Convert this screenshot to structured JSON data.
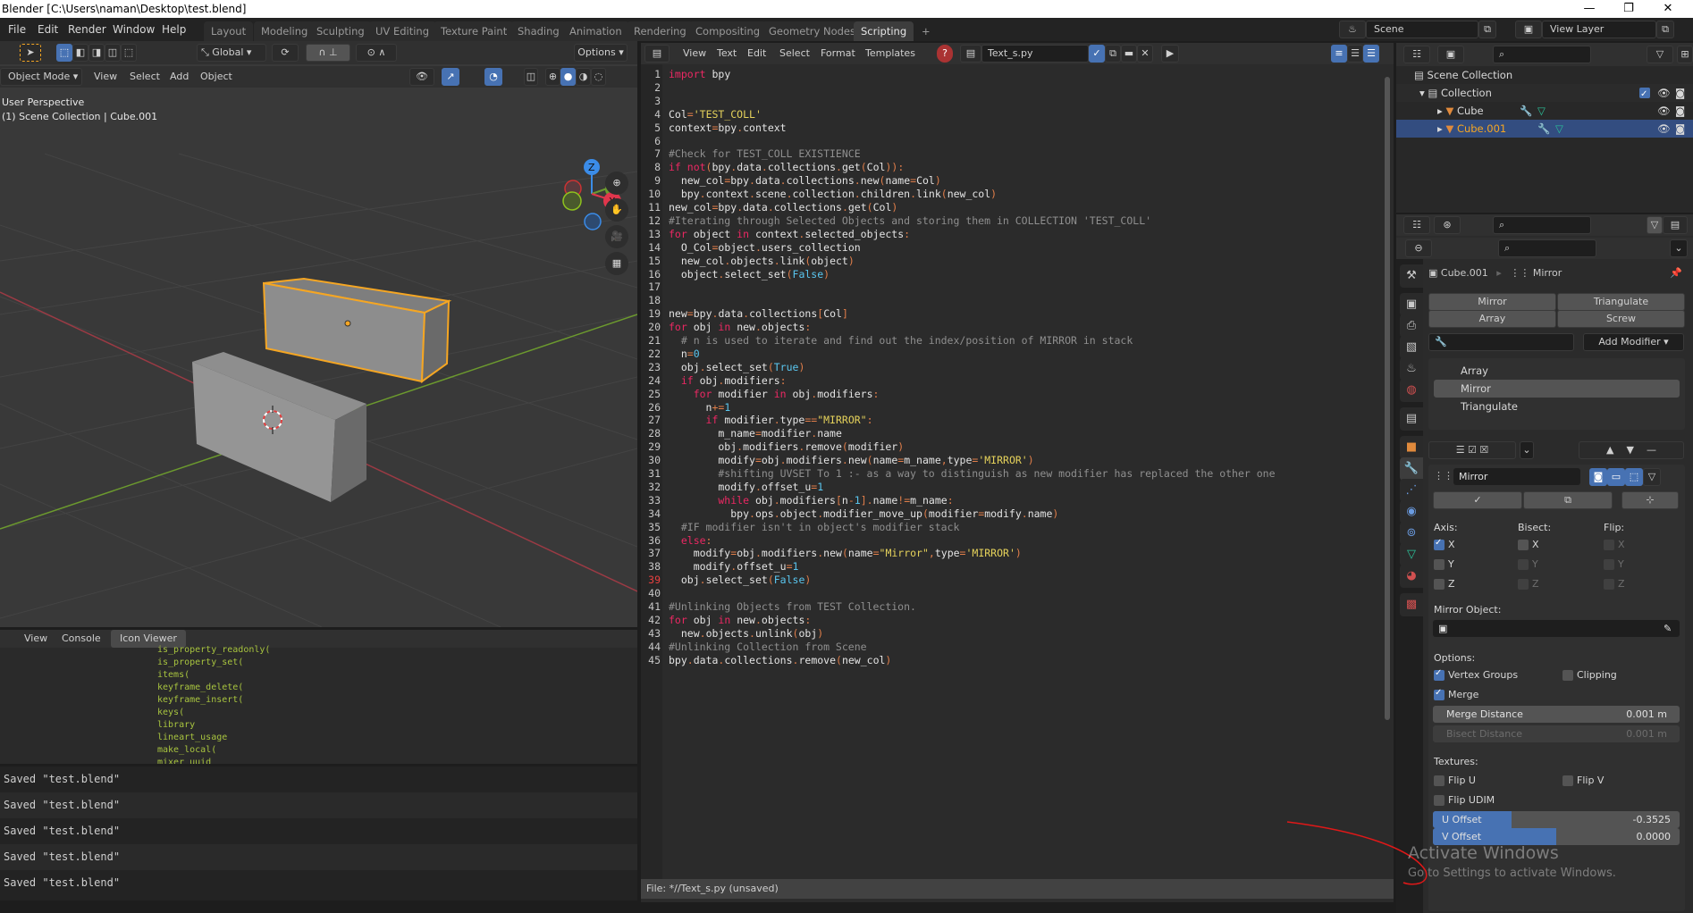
{
  "window": {
    "title": "Blender [C:\\Users\\naman\\Desktop\\test.blend]",
    "controls": {
      "minimize": "—",
      "maximize": "❐",
      "close": "✕"
    }
  },
  "menu": [
    "File",
    "Edit",
    "Render",
    "Window",
    "Help"
  ],
  "workspaces": {
    "tabs": [
      "Layout",
      "Modeling",
      "Sculpting",
      "UV Editing",
      "Texture Paint",
      "Shading",
      "Animation",
      "Rendering",
      "Compositing",
      "Geometry Nodes",
      "Scripting"
    ],
    "active": "Scripting",
    "add": "+"
  },
  "scene": {
    "name": "Scene",
    "view_layer": "View Layer"
  },
  "viewport": {
    "toolbar": {
      "orientation": "Global",
      "options": "Options"
    },
    "mode": "Object Mode",
    "menus": [
      "View",
      "Select",
      "Add",
      "Object"
    ],
    "overlay_text": [
      "User Perspective",
      "(1) Scene Collection | Cube.001"
    ],
    "gizmo": {
      "z": "Z",
      "y": "Y",
      "x": "X"
    }
  },
  "console": {
    "tabs": [
      "View",
      "Console",
      "Icon Viewer"
    ],
    "active_tab": "Icon Viewer",
    "lines": [
      "is_property_readonly(",
      "is_property_set(",
      "items(",
      "keyframe_delete(",
      "keyframe_insert(",
      "keys(",
      "library",
      "lineart_usage",
      "make_local(",
      "mixer_uuid"
    ]
  },
  "info_log": [
    "Saved \"test.blend\"",
    "Saved \"test.blend\"",
    "Saved \"test.blend\"",
    "Saved \"test.blend\"",
    "Saved \"test.blend\""
  ],
  "text_editor": {
    "menus": [
      "View",
      "Text",
      "Edit",
      "Select",
      "Format",
      "Templates"
    ],
    "filename": "Text_s.py",
    "footer": "File: *//Text_s.py (unsaved)",
    "current_line": 39,
    "code": [
      [
        [
          "k",
          "import"
        ],
        [
          "",
          "  bpy"
        ]
      ],
      [],
      [],
      [
        [
          "",
          "Col"
        ],
        [
          "p",
          "="
        ],
        [
          "s",
          "'TEST_COLL'"
        ]
      ],
      [
        [
          "",
          "context"
        ],
        [
          "p",
          "="
        ],
        [
          "",
          "bpy"
        ],
        [
          "p",
          "."
        ],
        [
          "",
          "context"
        ]
      ],
      [],
      [
        [
          "c",
          "#Check for TEST_COLL EXISTIENCE"
        ]
      ],
      [
        [
          "k",
          "if not"
        ],
        [
          "p",
          "("
        ],
        [
          "",
          "bpy"
        ],
        [
          "p",
          "."
        ],
        [
          "",
          "data"
        ],
        [
          "p",
          "."
        ],
        [
          "",
          "collections"
        ],
        [
          "p",
          "."
        ],
        [
          "",
          "get"
        ],
        [
          "p",
          "("
        ],
        [
          "",
          "Col"
        ],
        [
          "p",
          "))"
        ],
        [
          "p",
          ":"
        ]
      ],
      [
        [
          "",
          "    new_col"
        ],
        [
          "p",
          "="
        ],
        [
          "",
          "bpy"
        ],
        [
          "p",
          "."
        ],
        [
          "",
          "data"
        ],
        [
          "p",
          "."
        ],
        [
          "",
          "collections"
        ],
        [
          "p",
          "."
        ],
        [
          "",
          "new"
        ],
        [
          "p",
          "("
        ],
        [
          "",
          "name"
        ],
        [
          "p",
          "="
        ],
        [
          "",
          "Col"
        ],
        [
          "p",
          ")"
        ]
      ],
      [
        [
          "",
          "    bpy"
        ],
        [
          "p",
          "."
        ],
        [
          "",
          "context"
        ],
        [
          "p",
          "."
        ],
        [
          "",
          "scene"
        ],
        [
          "p",
          "."
        ],
        [
          "",
          "collection"
        ],
        [
          "p",
          "."
        ],
        [
          "",
          "children"
        ],
        [
          "p",
          "."
        ],
        [
          "",
          "link"
        ],
        [
          "p",
          "("
        ],
        [
          "",
          "new_col"
        ],
        [
          "p",
          ")"
        ]
      ],
      [
        [
          "",
          "new_col"
        ],
        [
          "p",
          "="
        ],
        [
          "",
          "bpy"
        ],
        [
          "p",
          "."
        ],
        [
          "",
          "data"
        ],
        [
          "p",
          "."
        ],
        [
          "",
          "collections"
        ],
        [
          "p",
          "."
        ],
        [
          "",
          "get"
        ],
        [
          "p",
          "("
        ],
        [
          "",
          "Col"
        ],
        [
          "p",
          ")"
        ]
      ],
      [
        [
          "c",
          "#Iterating through Selected Objects and storing them in COLLECTION 'TEST_COLL'"
        ]
      ],
      [
        [
          "k",
          "for"
        ],
        [
          "",
          "  object "
        ],
        [
          "k",
          "in"
        ],
        [
          "",
          "  context"
        ],
        [
          "p",
          "."
        ],
        [
          "",
          "selected_objects"
        ],
        [
          "p",
          ":"
        ]
      ],
      [
        [
          "",
          "    O_Col"
        ],
        [
          "p",
          "="
        ],
        [
          "",
          "object"
        ],
        [
          "p",
          "."
        ],
        [
          "",
          "users_collection"
        ]
      ],
      [
        [
          "",
          "    new_col"
        ],
        [
          "p",
          "."
        ],
        [
          "",
          "objects"
        ],
        [
          "p",
          "."
        ],
        [
          "",
          "link"
        ],
        [
          "p",
          "("
        ],
        [
          "",
          "object"
        ],
        [
          "p",
          ")"
        ]
      ],
      [
        [
          "",
          "    object"
        ],
        [
          "p",
          "."
        ],
        [
          "",
          "select_set"
        ],
        [
          "p",
          "("
        ],
        [
          "n",
          "False"
        ],
        [
          "p",
          ")"
        ]
      ],
      [],
      [],
      [
        [
          "",
          "new"
        ],
        [
          "p",
          "="
        ],
        [
          "",
          "bpy"
        ],
        [
          "p",
          "."
        ],
        [
          "",
          "data"
        ],
        [
          "p",
          "."
        ],
        [
          "",
          "collections"
        ],
        [
          "p",
          "["
        ],
        [
          "",
          "Col"
        ],
        [
          "p",
          "]"
        ]
      ],
      [
        [
          "k",
          "for"
        ],
        [
          "",
          "  obj "
        ],
        [
          "k",
          "in"
        ],
        [
          "",
          "  new"
        ],
        [
          "p",
          "."
        ],
        [
          "",
          "objects"
        ],
        [
          "p",
          ":"
        ]
      ],
      [
        [
          "c",
          "    # n is used to iterate and find out the index/position of MIRROR in stack"
        ]
      ],
      [
        [
          "",
          "    n"
        ],
        [
          "p",
          "="
        ],
        [
          "n",
          "0"
        ]
      ],
      [
        [
          "",
          "    obj"
        ],
        [
          "p",
          "."
        ],
        [
          "",
          "select_set"
        ],
        [
          "p",
          "("
        ],
        [
          "n",
          "True"
        ],
        [
          "p",
          ")"
        ]
      ],
      [
        [
          "k",
          "    if"
        ],
        [
          "",
          "  obj"
        ],
        [
          "p",
          "."
        ],
        [
          "",
          "modifiers"
        ],
        [
          "p",
          ":"
        ]
      ],
      [
        [
          "k",
          "        for"
        ],
        [
          "",
          "  modifier "
        ],
        [
          "k",
          "in"
        ],
        [
          "",
          "  obj"
        ],
        [
          "p",
          "."
        ],
        [
          "",
          "modifiers"
        ],
        [
          "p",
          ":"
        ]
      ],
      [
        [
          "",
          "            n"
        ],
        [
          "p",
          "+="
        ],
        [
          "n",
          "1"
        ]
      ],
      [
        [
          "k",
          "            if"
        ],
        [
          "",
          "  modifier"
        ],
        [
          "p",
          "."
        ],
        [
          "",
          "type"
        ],
        [
          "p",
          "=="
        ],
        [
          "s",
          "\"MIRROR\""
        ],
        [
          "p",
          ":"
        ]
      ],
      [
        [
          "",
          "                m_name"
        ],
        [
          "p",
          "="
        ],
        [
          "",
          "modifier"
        ],
        [
          "p",
          "."
        ],
        [
          "",
          "name"
        ]
      ],
      [
        [
          "",
          "                obj"
        ],
        [
          "p",
          "."
        ],
        [
          "",
          "modifiers"
        ],
        [
          "p",
          "."
        ],
        [
          "",
          "remove"
        ],
        [
          "p",
          "("
        ],
        [
          "",
          "modifier"
        ],
        [
          "p",
          ")"
        ]
      ],
      [
        [
          "",
          "                modify"
        ],
        [
          "p",
          "="
        ],
        [
          "",
          "obj"
        ],
        [
          "p",
          "."
        ],
        [
          "",
          "modifiers"
        ],
        [
          "p",
          "."
        ],
        [
          "",
          "new"
        ],
        [
          "p",
          "("
        ],
        [
          "",
          "name"
        ],
        [
          "p",
          "="
        ],
        [
          "",
          "m_name"
        ],
        [
          "p",
          ","
        ],
        [
          "",
          "type"
        ],
        [
          "p",
          "="
        ],
        [
          "s",
          "'MIRROR'"
        ],
        [
          "p",
          ")"
        ]
      ],
      [
        [
          "c",
          "                #shifting UVSET To 1 :- as a way to distinguish as new modifier has replaced the other one"
        ]
      ],
      [
        [
          "",
          "                modify"
        ],
        [
          "p",
          "."
        ],
        [
          "",
          "offset_u"
        ],
        [
          "p",
          "="
        ],
        [
          "n",
          "1"
        ]
      ],
      [
        [
          "k",
          "                while"
        ],
        [
          "",
          "  obj"
        ],
        [
          "p",
          "."
        ],
        [
          "",
          "modifiers"
        ],
        [
          "p",
          "["
        ],
        [
          "",
          "n"
        ],
        [
          "p",
          "-"
        ],
        [
          "n",
          "1"
        ],
        [
          "p",
          "]."
        ],
        [
          "",
          "name"
        ],
        [
          "p",
          "!="
        ],
        [
          "",
          "m_name"
        ],
        [
          "p",
          ":"
        ]
      ],
      [
        [
          "",
          "                    bpy"
        ],
        [
          "p",
          "."
        ],
        [
          "",
          "ops"
        ],
        [
          "p",
          "."
        ],
        [
          "",
          "object"
        ],
        [
          "p",
          "."
        ],
        [
          "",
          "modifier_move_up"
        ],
        [
          "p",
          "("
        ],
        [
          "",
          "modifier"
        ],
        [
          "p",
          "="
        ],
        [
          "",
          "modify"
        ],
        [
          "p",
          "."
        ],
        [
          "",
          "name"
        ],
        [
          "p",
          ")"
        ]
      ],
      [
        [
          "c",
          "    #IF modifier isn't in object's modifier stack"
        ]
      ],
      [
        [
          "k",
          "    else"
        ],
        [
          "p",
          ":"
        ]
      ],
      [
        [
          "",
          "        modify"
        ],
        [
          "p",
          "="
        ],
        [
          "",
          "obj"
        ],
        [
          "p",
          "."
        ],
        [
          "",
          "modifiers"
        ],
        [
          "p",
          "."
        ],
        [
          "",
          "new"
        ],
        [
          "p",
          "("
        ],
        [
          "",
          "name"
        ],
        [
          "p",
          "="
        ],
        [
          "s",
          "\"Mirror\""
        ],
        [
          "p",
          ","
        ],
        [
          "",
          "type"
        ],
        [
          "p",
          "="
        ],
        [
          "s",
          "'MIRROR'"
        ],
        [
          "p",
          ")"
        ]
      ],
      [
        [
          "",
          "        modify"
        ],
        [
          "p",
          "."
        ],
        [
          "",
          "offset_u"
        ],
        [
          "p",
          "="
        ],
        [
          "n",
          "1"
        ]
      ],
      [
        [
          "",
          "    obj"
        ],
        [
          "p",
          "."
        ],
        [
          "",
          "select_set"
        ],
        [
          "p",
          "("
        ],
        [
          "n",
          "False"
        ],
        [
          "p",
          ")"
        ]
      ],
      [],
      [
        [
          "c",
          "#Unlinking Objects from TEST Collection."
        ]
      ],
      [
        [
          "k",
          "for"
        ],
        [
          "",
          "  obj "
        ],
        [
          "k",
          "in"
        ],
        [
          "",
          "  new"
        ],
        [
          "p",
          "."
        ],
        [
          "",
          "objects"
        ],
        [
          "p",
          ":"
        ]
      ],
      [
        [
          "",
          "    new"
        ],
        [
          "p",
          "."
        ],
        [
          "",
          "objects"
        ],
        [
          "p",
          "."
        ],
        [
          "",
          "unlink"
        ],
        [
          "p",
          "("
        ],
        [
          "",
          "obj"
        ],
        [
          "p",
          ")"
        ]
      ],
      [
        [
          "c",
          "#Unlinking Collection from Scene"
        ]
      ],
      [
        [
          "",
          "bpy"
        ],
        [
          "p",
          "."
        ],
        [
          "",
          "data"
        ],
        [
          "p",
          "."
        ],
        [
          "",
          "collections"
        ],
        [
          "p",
          "."
        ],
        [
          "",
          "remove"
        ],
        [
          "p",
          "("
        ],
        [
          "",
          "new_col"
        ],
        [
          "p",
          ")"
        ]
      ]
    ]
  },
  "outliner": {
    "rows": [
      {
        "label": "Scene Collection",
        "icon": "scene-collection-icon"
      },
      {
        "label": "Collection",
        "icon": "collection-icon"
      },
      {
        "label": "Cube",
        "icon": "mesh-object-icon"
      },
      {
        "label": "Cube.001",
        "icon": "mesh-object-icon",
        "selected": true
      }
    ]
  },
  "properties": {
    "breadcrumb": {
      "object": "Cube.001",
      "modifier": "Mirror"
    },
    "quick_add": [
      "Mirror",
      "Triangulate",
      "Array",
      "Screw"
    ],
    "add_modifier": "Add Modifier",
    "stack": [
      "Array",
      "Mirror",
      "Triangulate"
    ],
    "active_modifier": "Mirror",
    "modifier_name": "Mirror",
    "axis_label": "Axis:",
    "bisect_label": "Bisect:",
    "flip_label": "Flip:",
    "axis": {
      "X": true,
      "Y": false,
      "Z": false
    },
    "bisect": {
      "X": false,
      "Y": false,
      "Z": false
    },
    "flip": {
      "X": false,
      "Y": false,
      "Z": false
    },
    "mirror_object_label": "Mirror Object:",
    "options_label": "Options:",
    "vertex_groups": {
      "label": "Vertex Groups",
      "checked": true
    },
    "clipping": {
      "label": "Clipping",
      "checked": false
    },
    "merge": {
      "label": "Merge",
      "checked": true
    },
    "merge_distance": {
      "label": "Merge Distance",
      "value": "0.001 m"
    },
    "bisect_distance": {
      "label": "Bisect Distance",
      "value": "0.001 m"
    },
    "textures_label": "Textures:",
    "flip_u": {
      "label": "Flip U",
      "checked": false
    },
    "flip_v": {
      "label": "Flip V",
      "checked": false
    },
    "flip_udim": {
      "label": "Flip UDIM",
      "checked": false
    },
    "u_offset": {
      "label": "U Offset",
      "value": "-0.3525",
      "fill": 0.32
    },
    "v_offset": {
      "label": "V Offset",
      "value": "0.0000",
      "fill": 0.5
    }
  },
  "watermark": {
    "line1": "Activate Windows",
    "line2": "Go to Settings to activate Windows."
  },
  "colors": {
    "accent": "#4772b3",
    "selected_object": "#f5a623",
    "keyword": "#ec2863",
    "string": "#e5d25b",
    "number": "#5ac6ef",
    "comment": "#8f8f8f"
  }
}
